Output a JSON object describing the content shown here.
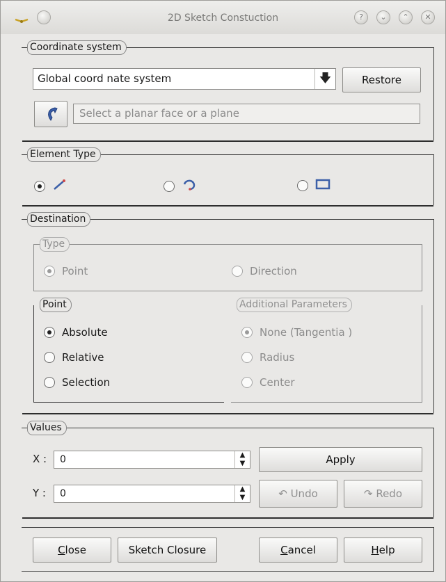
{
  "window": {
    "title": "2D Sketch Constuction"
  },
  "titlebar": {
    "buttons": {
      "help": "?",
      "shade": "⌄",
      "maximize": "⌃",
      "close": "✕"
    }
  },
  "coordinate_system": {
    "legend": "Coordinate system",
    "selected": "Global coord nate system",
    "restore_label": "Restore",
    "plane_placeholder": "Select a planar face or a plane"
  },
  "element_type": {
    "legend": "Element Type",
    "options": [
      {
        "icon": "segment-icon",
        "checked": true
      },
      {
        "icon": "arc-icon",
        "checked": false
      },
      {
        "icon": "rectangle-icon",
        "checked": false
      }
    ]
  },
  "destination": {
    "legend": "Destination",
    "type": {
      "legend": "Type",
      "point_label": "Point",
      "direction_label": "Direction"
    },
    "point": {
      "legend": "Point",
      "absolute_label": "Absolute",
      "relative_label": "Relative",
      "selection_label": "Selection"
    },
    "additional": {
      "legend": "Additional Parameters",
      "none_label": "None (Tangentia )",
      "radius_label": "Radius",
      "center_label": "Center"
    }
  },
  "values": {
    "legend": "Values",
    "x_label": "X :",
    "x_value": "0",
    "y_label": "Y :",
    "y_value": "0",
    "apply_label": "Apply",
    "undo_label": "Undo",
    "redo_label": "Redo"
  },
  "footer": {
    "close_rest": "lose",
    "close_mnemonic": "C",
    "sketch_closure_label": "Sketch Closure",
    "cancel_rest": "ancel",
    "cancel_mnemonic": "C",
    "help_rest": "elp",
    "help_mnemonic": "H"
  },
  "colors": {
    "window_bg": "#e9e8e6",
    "accent_icon": "#3b5fa8"
  }
}
